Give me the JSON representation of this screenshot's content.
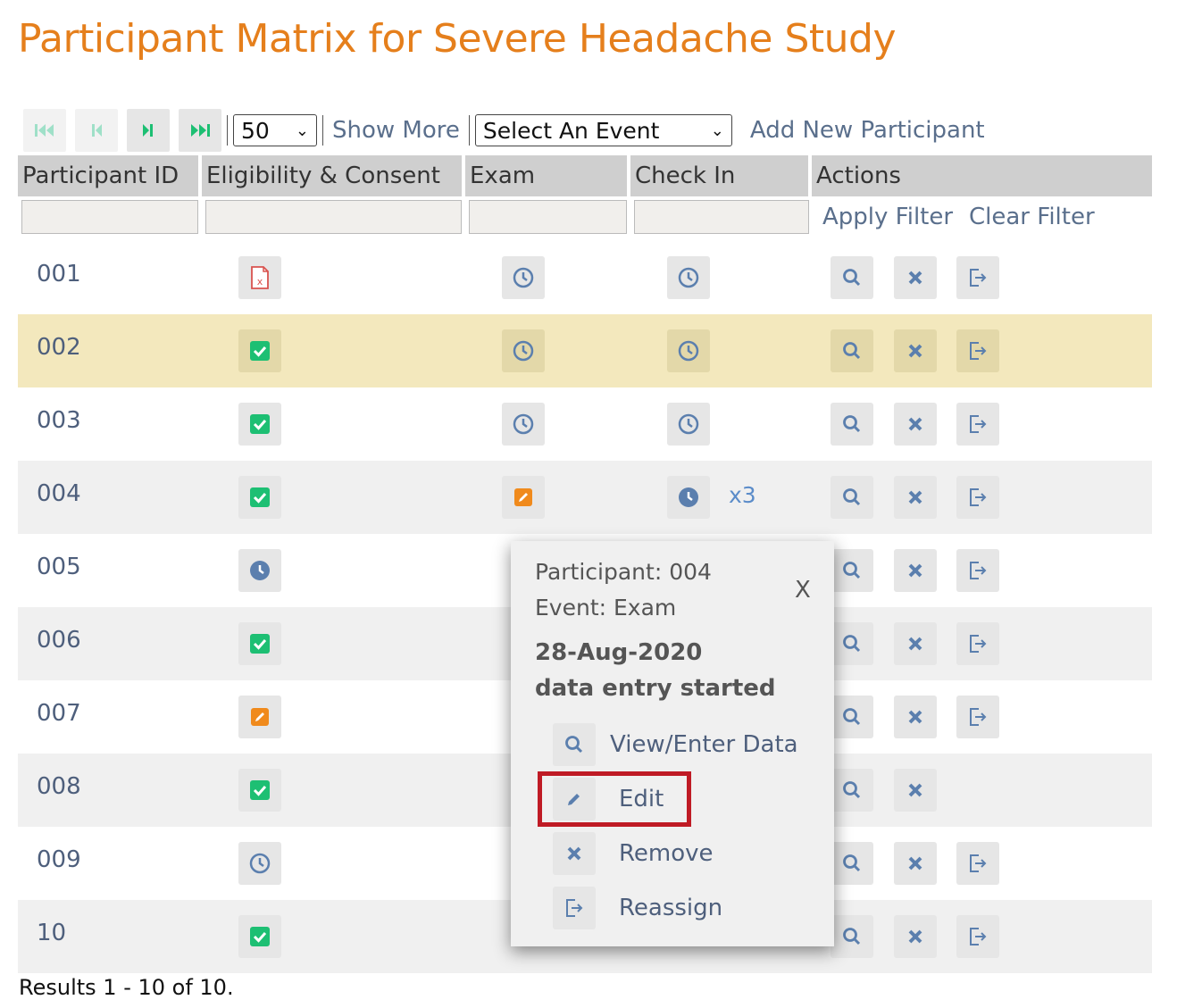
{
  "title": "Participant  Matrix for Severe  Headache Study",
  "toolbar": {
    "page_size": "50",
    "show_more": "Show More",
    "event_select": "Select An Event",
    "add_participant": "Add New Participant"
  },
  "columns": [
    "Participant ID",
    "Eligibility & Consent",
    "Exam",
    "Check In",
    "Actions"
  ],
  "filter": {
    "apply": "Apply Filter",
    "clear": "Clear Filter"
  },
  "rows": [
    {
      "id": "001",
      "eligibility": "invalid-doc-icon",
      "exam": "clock-outline-icon",
      "checkin": "clock-outline-icon"
    },
    {
      "id": "002",
      "eligibility": "check-icon",
      "exam": "clock-outline-icon",
      "checkin": "clock-outline-icon"
    },
    {
      "id": "003",
      "eligibility": "check-icon",
      "exam": "clock-outline-icon",
      "checkin": "clock-outline-icon"
    },
    {
      "id": "004",
      "eligibility": "check-icon",
      "exam": "pencil-icon",
      "checkin": "clock-filled-icon",
      "checkin_count": "x3"
    },
    {
      "id": "005",
      "eligibility": "clock-filled-icon"
    },
    {
      "id": "006",
      "eligibility": "check-icon"
    },
    {
      "id": "007",
      "eligibility": "pencil-icon"
    },
    {
      "id": "008",
      "eligibility": "check-icon"
    },
    {
      "id": "009",
      "eligibility": "clock-outline-icon"
    },
    {
      "id": "10",
      "eligibility": "check-icon"
    }
  ],
  "results": "Results 1 - 10 of 10.",
  "popup": {
    "participant": "Participant: 004",
    "event": "Event: Exam",
    "date": "28-Aug-2020",
    "status": "data entry started",
    "close": "X",
    "actions": {
      "view": "View/Enter Data",
      "edit": "Edit",
      "remove": "Remove",
      "reassign": "Reassign"
    }
  },
  "colors": {
    "title": "#e57f1c",
    "check": "#1dbf73",
    "pencil": "#f08a1c",
    "icon": "#5b7fae",
    "highlight_row": "#f3e8bd",
    "edit_outline": "#bf1b25"
  }
}
